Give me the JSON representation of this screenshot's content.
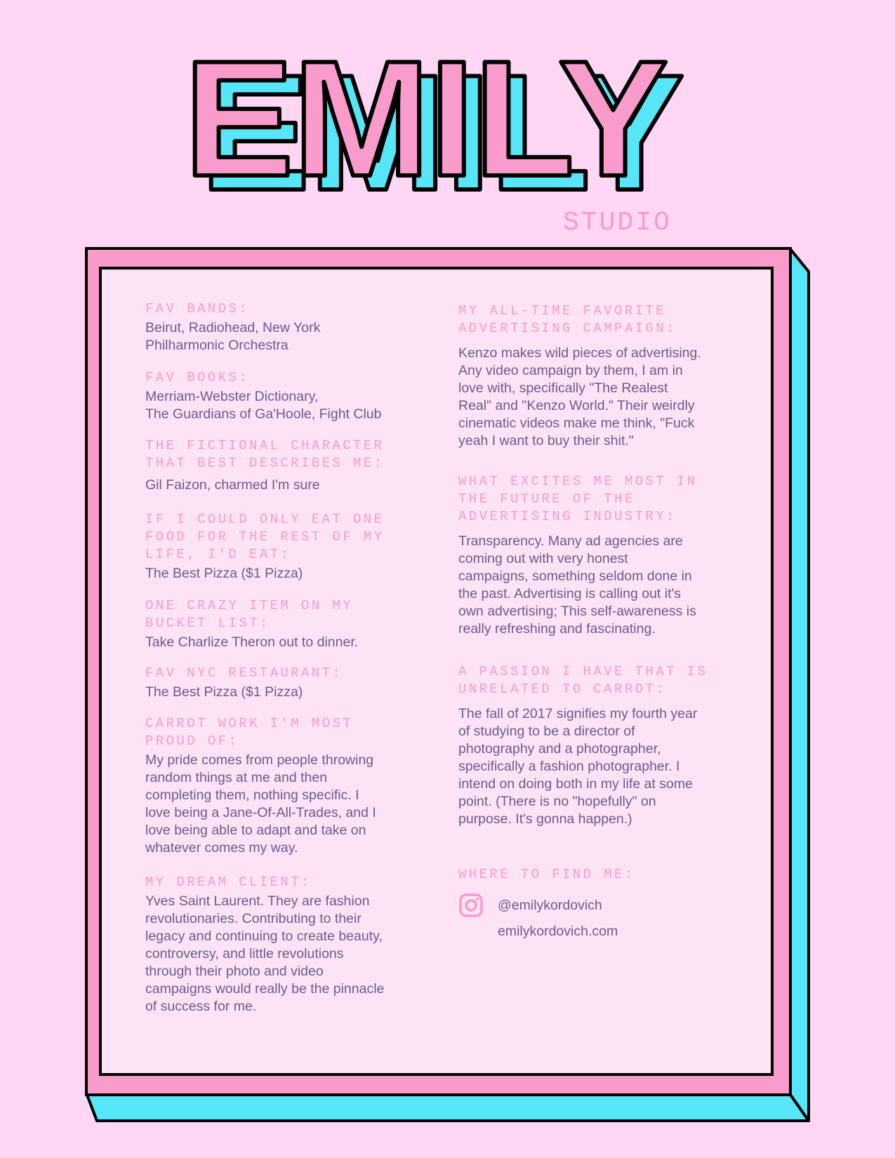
{
  "header": {
    "title": "EMILY",
    "subtitle": "STUDIO"
  },
  "colors": {
    "background": "#FFD6F3",
    "pink": "#F99BCB",
    "cyan": "#57E6F7",
    "panel": "#FDE3F6",
    "text": "#6A5C8F"
  },
  "left": [
    {
      "heading": "FAV BANDS:",
      "body": "Beirut, Radiohead, New York\nPhilharmonic Orchestra"
    },
    {
      "heading": "FAV BOOKS:",
      "body": "Merriam-Webster Dictionary,\nThe Guardians of Ga'Hoole, Fight Club"
    },
    {
      "heading": "THE FICTIONAL CHARACTER\nTHAT BEST DESCRIBES ME:",
      "body": "Gil Faizon, charmed I'm sure"
    },
    {
      "heading": "IF I COULD ONLY EAT ONE\nFOOD FOR THE REST OF MY\nLIFE, I'D EAT:",
      "body": "The Best Pizza ($1 Pizza)"
    },
    {
      "heading": "ONE CRAZY ITEM ON MY\nBUCKET LIST:",
      "body": "Take Charlize Theron out to dinner."
    },
    {
      "heading": "FAV NYC RESTAURANT:",
      "body": "The Best Pizza ($1 Pizza)"
    },
    {
      "heading": "CARROT WORK I'M MOST\nPROUD OF:",
      "body": "My pride comes from people throwing\nrandom things at me and then\ncompleting them, nothing specific. I\nlove being a Jane-Of-All-Trades, and I\nlove being able to adapt and take on\nwhatever comes my way."
    },
    {
      "heading": "MY DREAM CLIENT:",
      "body": "Yves Saint Laurent. They are fashion\nrevolutionaries. Contributing to their\nlegacy and continuing to create beauty,\ncontroversy, and little revolutions\nthrough their photo and video\ncampaigns would really be the pinnacle\nof success for me."
    }
  ],
  "right": [
    {
      "heading": "MY ALL-TIME FAVORITE\nADVERTISING CAMPAIGN:",
      "body": "Kenzo makes wild pieces of advertising.\nAny video campaign by them, I am in\nlove with, specifically \"The Realest\nReal\" and \"Kenzo World.\" Their weirdly\ncinematic videos make me think, \"Fuck\nyeah I want to buy their shit.\""
    },
    {
      "heading": "WHAT EXCITES ME MOST IN\nTHE FUTURE OF THE\nADVERTISING INDUSTRY:",
      "body": "Transparency. Many ad agencies are\ncoming out with very honest\ncampaigns, something seldom done in\nthe past. Advertising is calling out it's\nown advertising; This self-awareness is\nreally refreshing and fascinating."
    },
    {
      "heading": "A PASSION I HAVE THAT IS\nUNRELATED TO CARROT:",
      "body": "The fall of 2017 signifies my fourth year\nof studying to be a director of\nphotography and a photographer,\nspecifically a fashion photographer. I\nintend on doing both in my life at some\npoint. (There is no \"hopefully\" on\npurpose. It's gonna happen.)"
    },
    {
      "heading": "WHERE TO FIND ME:"
    }
  ],
  "contact": {
    "instagram_icon": "instagram-icon",
    "instagram": "@emilykordovich",
    "website": "emilykordovich.com"
  }
}
